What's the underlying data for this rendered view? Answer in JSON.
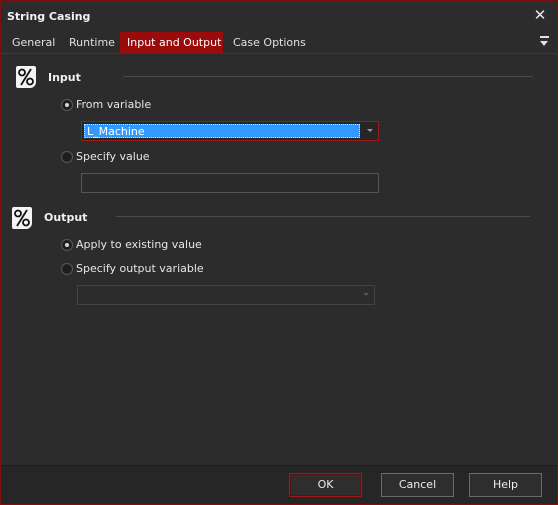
{
  "window": {
    "title": "String Casing"
  },
  "tabs": [
    {
      "label": "General",
      "active": false
    },
    {
      "label": "Runtime",
      "active": false
    },
    {
      "label": "Input and Output",
      "active": true
    },
    {
      "label": "Case Options",
      "active": false
    }
  ],
  "input_section": {
    "heading": "Input",
    "from_variable_label": "From variable",
    "from_variable_checked": true,
    "from_variable_value": "L_Machine",
    "specify_value_label": "Specify value",
    "specify_value_checked": false,
    "specify_value_text": ""
  },
  "output_section": {
    "heading": "Output",
    "apply_existing_label": "Apply to existing value",
    "apply_existing_checked": true,
    "specify_output_label": "Specify output variable",
    "specify_output_checked": false,
    "output_variable_value": ""
  },
  "buttons": {
    "ok": "OK",
    "cancel": "Cancel",
    "help": "Help"
  },
  "colors": {
    "accent": "#9a0c0c",
    "selection": "#3399ff",
    "background": "#2c2c2c"
  },
  "icons": {
    "close": "close-icon",
    "tab_menu": "menu-dropdown-icon",
    "section": "percent-icon"
  }
}
